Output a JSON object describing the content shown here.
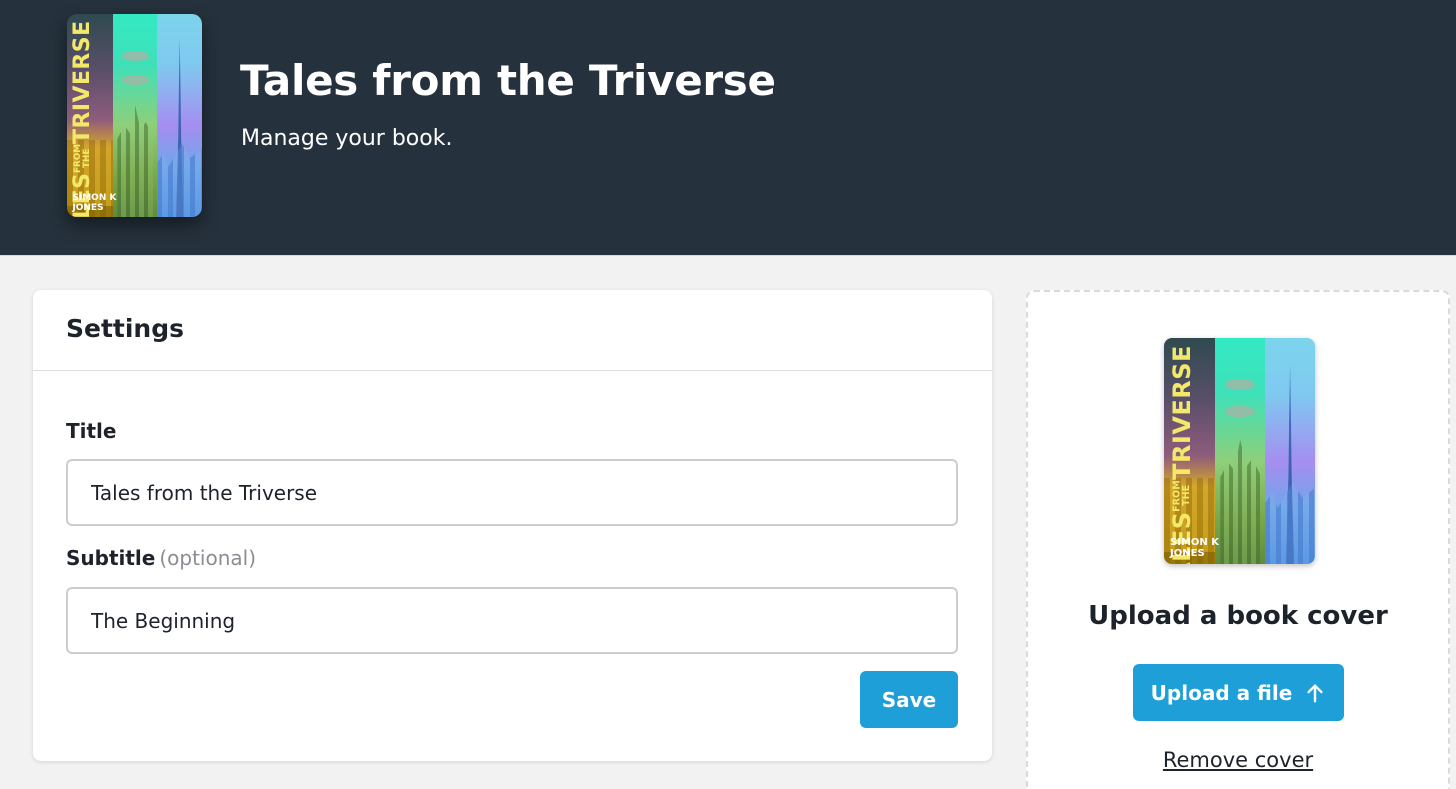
{
  "header": {
    "title": "Tales from the Triverse",
    "subtitle": "Manage your book."
  },
  "cover": {
    "title_line1": "TALES",
    "title_from": "FROM",
    "title_the": "THE",
    "title_line2": "TRIVERSE",
    "author_line1": "SIMON K",
    "author_line2": "JONES"
  },
  "settings": {
    "heading": "Settings",
    "title_label": "Title",
    "title_value": "Tales from the Triverse",
    "subtitle_label": "Subtitle",
    "subtitle_optional": "(optional)",
    "subtitle_value": "The Beginning",
    "save_label": "Save"
  },
  "cover_panel": {
    "heading": "Upload a book cover",
    "upload_label": "Upload a file",
    "upload_icon": "arrow-up-icon",
    "remove_label": "Remove cover"
  },
  "colors": {
    "header_bg": "#25313c",
    "accent": "#1f9fd8",
    "page_bg": "#f1f2f1"
  }
}
